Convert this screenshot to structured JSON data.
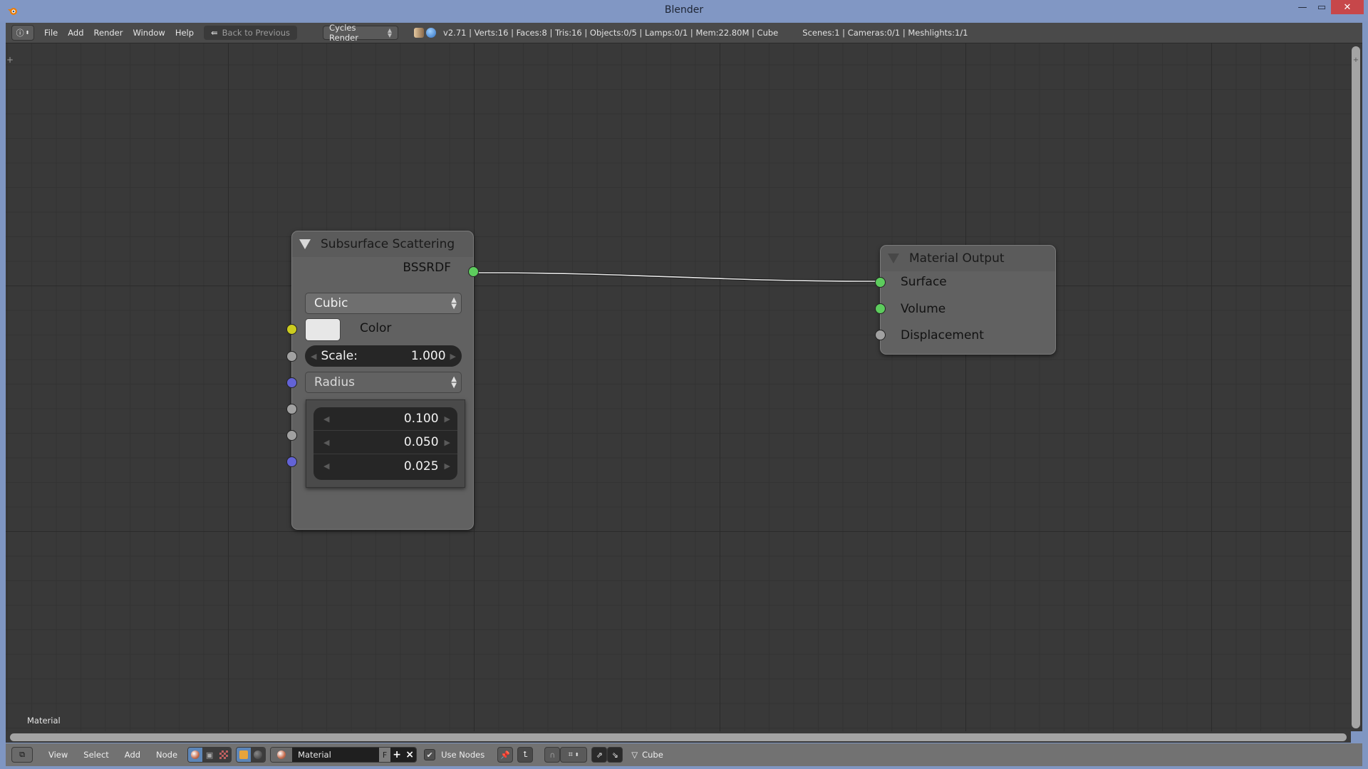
{
  "window": {
    "title": "Blender",
    "minimize_icon": "minimize-icon",
    "maximize_icon": "maximize-icon",
    "close_icon": "close-icon"
  },
  "info_header": {
    "editor_type_icon": "info-icon",
    "menus": [
      "File",
      "Add",
      "Render",
      "Window",
      "Help"
    ],
    "back_button": "Back to Previous",
    "render_engine": "Cycles Render",
    "stats": "v2.71 | Verts:16 | Faces:8 | Tris:16 | Objects:0/5 | Lamps:0/1 | Mem:22.80M | Cube",
    "stats_scene": "Scenes:1 | Cameras:0/1 | Meshlights:1/1"
  },
  "node_editor": {
    "context_label": "Material",
    "colors": {
      "socket_shader": "#5dcc5d",
      "socket_color": "#cccc1f",
      "socket_float": "#a1a1a1",
      "socket_vector": "#6363d6"
    },
    "nodes": {
      "sss": {
        "title": "Subsurface Scattering",
        "output": "BSSRDF",
        "falloff": "Cubic",
        "color_label": "Color",
        "color_value": "#e7e7e7",
        "scale_label": "Scale:",
        "scale_value": "1.000",
        "radius_label": "Radius",
        "radius_values": [
          "0.100",
          "0.050",
          "0.025"
        ]
      },
      "output": {
        "title": "Material Output",
        "inputs": [
          "Surface",
          "Volume",
          "Displacement"
        ]
      }
    },
    "links": [
      {
        "from": "Subsurface Scattering.BSSRDF",
        "to": "Material Output.Surface"
      }
    ]
  },
  "bottom_header": {
    "editor_type_icon": "node-editor-icon",
    "menus": [
      "View",
      "Select",
      "Add",
      "Node"
    ],
    "shader_types": [
      "object",
      "world",
      "texture"
    ],
    "material_slot_icon": "material-icon",
    "material_name": "Material",
    "fake_user": "F",
    "add_label": "+",
    "unlink_label": "×",
    "use_nodes_checked": true,
    "use_nodes_label": "Use Nodes",
    "object_name": "Cube"
  }
}
